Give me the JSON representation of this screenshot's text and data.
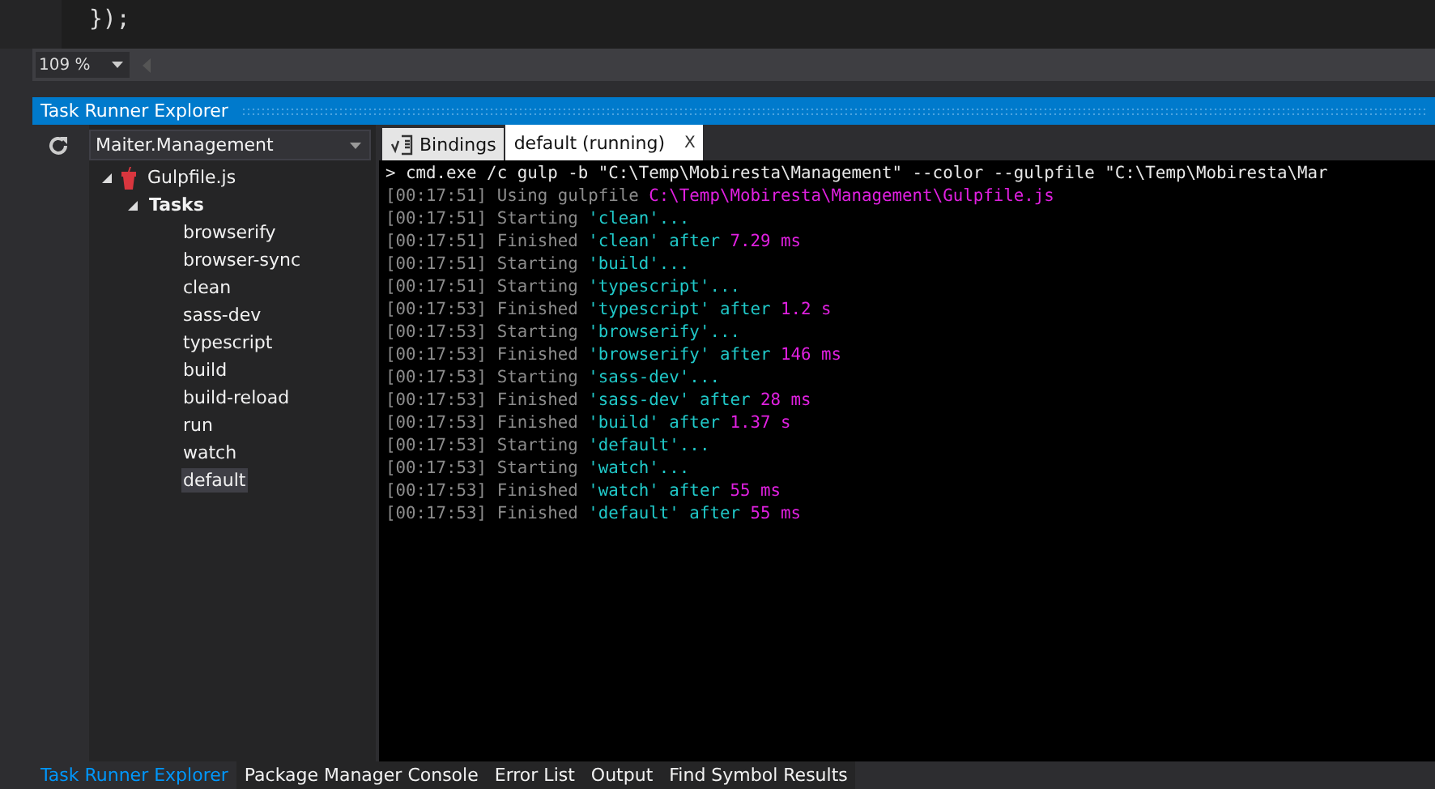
{
  "editor": {
    "code_line": "});"
  },
  "zoom": {
    "value": "109 %"
  },
  "panel": {
    "title": "Task Runner Explorer"
  },
  "project_dropdown": {
    "value": "Maiter.Management"
  },
  "tree": [
    {
      "label": "Gulpfile.js",
      "kind": "file",
      "expanded": true,
      "children": [
        {
          "label": "Tasks",
          "kind": "group",
          "expanded": true,
          "children": [
            {
              "label": "browserify",
              "kind": "task",
              "selected": false
            },
            {
              "label": "browser-sync",
              "kind": "task",
              "selected": false
            },
            {
              "label": "clean",
              "kind": "task",
              "selected": false
            },
            {
              "label": "sass-dev",
              "kind": "task",
              "selected": false
            },
            {
              "label": "typescript",
              "kind": "task",
              "selected": false
            },
            {
              "label": "build",
              "kind": "task",
              "selected": false
            },
            {
              "label": "build-reload",
              "kind": "task",
              "selected": false
            },
            {
              "label": "run",
              "kind": "task",
              "selected": false
            },
            {
              "label": "watch",
              "kind": "task",
              "selected": false
            },
            {
              "label": "default",
              "kind": "task",
              "selected": true
            }
          ]
        }
      ]
    }
  ],
  "tabs": [
    {
      "label": "Bindings",
      "selected": false
    },
    {
      "label": "default (running)",
      "selected": true,
      "close": "X"
    }
  ],
  "console": [
    [
      {
        "kind": "command",
        "text": "> cmd.exe /c gulp -b \"C:\\Temp\\Mobiresta\\Management\" --color --gulpfile \"C:\\Temp\\Mobiresta\\Mar"
      }
    ],
    [
      {
        "kind": "time",
        "text": "[00:17:51]"
      },
      {
        "kind": "text",
        "text": " Using gulpfile "
      },
      {
        "kind": "value",
        "text": "C:\\Temp\\Mobiresta\\Management\\Gulpfile.js"
      }
    ],
    [
      {
        "kind": "time",
        "text": "[00:17:51]"
      },
      {
        "kind": "text",
        "text": " Starting "
      },
      {
        "kind": "name",
        "text": "'clean'..."
      }
    ],
    [
      {
        "kind": "time",
        "text": "[00:17:51]"
      },
      {
        "kind": "text",
        "text": " Finished "
      },
      {
        "kind": "name",
        "text": "'clean' after "
      },
      {
        "kind": "value",
        "text": "7.29 ms"
      }
    ],
    [
      {
        "kind": "time",
        "text": "[00:17:51]"
      },
      {
        "kind": "text",
        "text": " Starting "
      },
      {
        "kind": "name",
        "text": "'build'..."
      }
    ],
    [
      {
        "kind": "time",
        "text": "[00:17:51]"
      },
      {
        "kind": "text",
        "text": " Starting "
      },
      {
        "kind": "name",
        "text": "'typescript'..."
      }
    ],
    [
      {
        "kind": "time",
        "text": "[00:17:53]"
      },
      {
        "kind": "text",
        "text": " Finished "
      },
      {
        "kind": "name",
        "text": "'typescript' after "
      },
      {
        "kind": "value",
        "text": "1.2 s"
      }
    ],
    [
      {
        "kind": "time",
        "text": "[00:17:53]"
      },
      {
        "kind": "text",
        "text": " Starting "
      },
      {
        "kind": "name",
        "text": "'browserify'..."
      }
    ],
    [
      {
        "kind": "time",
        "text": "[00:17:53]"
      },
      {
        "kind": "text",
        "text": " Finished "
      },
      {
        "kind": "name",
        "text": "'browserify' after "
      },
      {
        "kind": "value",
        "text": "146 ms"
      }
    ],
    [
      {
        "kind": "time",
        "text": "[00:17:53]"
      },
      {
        "kind": "text",
        "text": " Starting "
      },
      {
        "kind": "name",
        "text": "'sass-dev'..."
      }
    ],
    [
      {
        "kind": "time",
        "text": "[00:17:53]"
      },
      {
        "kind": "text",
        "text": " Finished "
      },
      {
        "kind": "name",
        "text": "'sass-dev' after "
      },
      {
        "kind": "value",
        "text": "28 ms"
      }
    ],
    [
      {
        "kind": "time",
        "text": "[00:17:53]"
      },
      {
        "kind": "text",
        "text": " Finished "
      },
      {
        "kind": "name",
        "text": "'build' after "
      },
      {
        "kind": "value",
        "text": "1.37 s"
      }
    ],
    [
      {
        "kind": "time",
        "text": "[00:17:53]"
      },
      {
        "kind": "text",
        "text": " Starting "
      },
      {
        "kind": "name",
        "text": "'default'..."
      }
    ],
    [
      {
        "kind": "time",
        "text": "[00:17:53]"
      },
      {
        "kind": "text",
        "text": " Starting "
      },
      {
        "kind": "name",
        "text": "'watch'..."
      }
    ],
    [
      {
        "kind": "time",
        "text": "[00:17:53]"
      },
      {
        "kind": "text",
        "text": " Finished "
      },
      {
        "kind": "name",
        "text": "'watch' after "
      },
      {
        "kind": "value",
        "text": "55 ms"
      }
    ],
    [
      {
        "kind": "time",
        "text": "[00:17:53]"
      },
      {
        "kind": "text",
        "text": " Finished "
      },
      {
        "kind": "name",
        "text": "'default' after "
      },
      {
        "kind": "value",
        "text": "55 ms"
      }
    ]
  ],
  "bottom_tabs": [
    {
      "label": "Task Runner Explorer",
      "selected": true
    },
    {
      "label": "Package Manager Console",
      "selected": false
    },
    {
      "label": "Error List",
      "selected": false
    },
    {
      "label": "Output",
      "selected": false
    },
    {
      "label": "Find Symbol Results",
      "selected": false
    }
  ]
}
